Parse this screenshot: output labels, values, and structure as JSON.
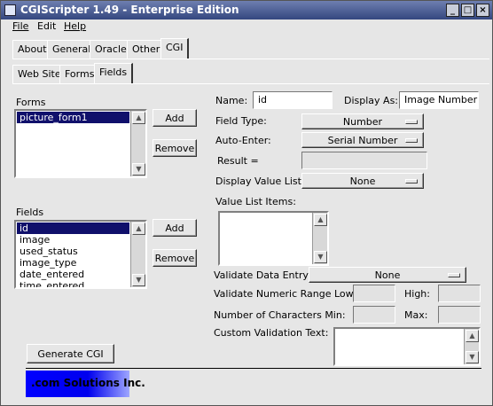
{
  "window": {
    "title": "CGIScripter 1.49 - Enterprise Edition"
  },
  "menu": {
    "file": "File",
    "edit": "Edit",
    "help": "Help"
  },
  "tabs_top": [
    "About",
    "General",
    "Oracle",
    "Other",
    "CGI"
  ],
  "tabs_sub": [
    "Web Site",
    "Forms",
    "Fields"
  ],
  "forms": {
    "label": "Forms",
    "items": [
      "picture_form1"
    ],
    "add": "Add",
    "remove": "Remove"
  },
  "fields": {
    "label": "Fields",
    "items": [
      "id",
      "image",
      "used_status",
      "image_type",
      "date_entered",
      "time_entered"
    ],
    "add": "Add",
    "remove": "Remove"
  },
  "props": {
    "name_label": "Name:",
    "name_value": "id",
    "display_as_label": "Display As:",
    "display_as_value": "Image Number",
    "field_type_label": "Field Type:",
    "field_type_value": "Number",
    "auto_enter_label": "Auto-Enter:",
    "auto_enter_value": "Serial Number",
    "result_label": "Result =",
    "display_value_list_label": "Display Value List:",
    "display_value_list_value": "None",
    "value_list_items_label": "Value List Items:",
    "validate_label": "Validate Data Entry:",
    "validate_value": "None",
    "range_low_label": "Validate Numeric Range Low:",
    "high_label": "High:",
    "chars_min_label": "Number of Characters Min:",
    "max_label": "Max:",
    "custom_text_label": "Custom Validation Text:"
  },
  "generate": "Generate CGI",
  "logo": ".com Solutions Inc."
}
